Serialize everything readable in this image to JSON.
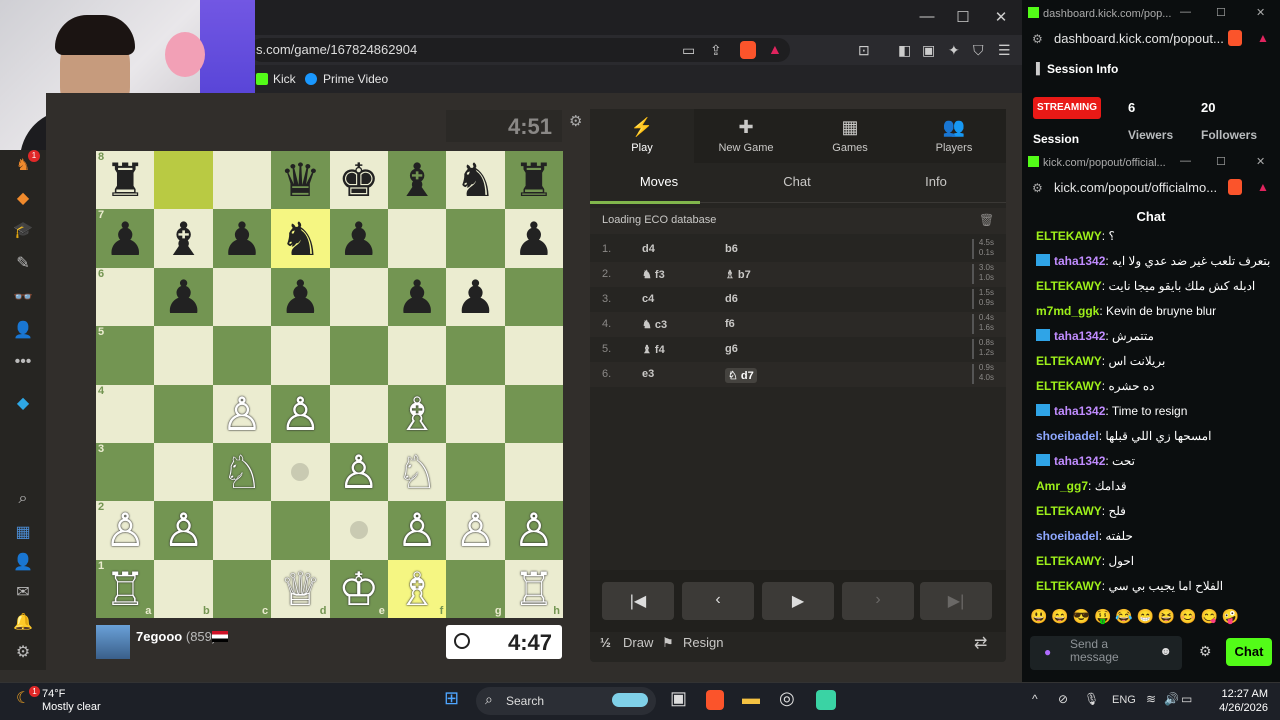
{
  "browser": {
    "url": "s.com/game/167824862904",
    "bookmarks": [
      "Kick",
      "Prime Video"
    ]
  },
  "sidebar": {
    "badge": "1"
  },
  "game": {
    "top_clock": "4:51",
    "bottom_clock": "4:47",
    "player_name": "7egooo",
    "player_rating": "(859)",
    "board": [
      [
        "♜",
        "",
        "",
        "♛",
        "♚",
        "♝",
        "♞",
        "♜"
      ],
      [
        "♟",
        "♝",
        "♟",
        "♞",
        "♟",
        "",
        "",
        "♟"
      ],
      [
        "",
        "♟",
        "",
        "♟",
        "",
        "♟",
        "♟",
        ""
      ],
      [
        "",
        "",
        "",
        "",
        "",
        "",
        "",
        ""
      ],
      [
        "",
        "",
        "♙",
        "♙",
        "",
        "♗",
        "",
        ""
      ],
      [
        "",
        "",
        "♘",
        "",
        "♙",
        "♘",
        "",
        ""
      ],
      [
        "♙",
        "♙",
        "",
        "",
        "",
        "♙",
        "♙",
        "♙"
      ],
      [
        "♖",
        "",
        "",
        "♕",
        "♔",
        "♗",
        "",
        "♖"
      ]
    ],
    "ranks": [
      "8",
      "7",
      "6",
      "5",
      "4",
      "3",
      "2",
      "1"
    ],
    "files": [
      "a",
      "b",
      "c",
      "d",
      "e",
      "f",
      "g",
      "h"
    ]
  },
  "panel": {
    "tabs": [
      {
        "label": "Play",
        "icon": "⚡"
      },
      {
        "label": "New Game",
        "icon": "✚"
      },
      {
        "label": "Games",
        "icon": "▦"
      },
      {
        "label": "Players",
        "icon": "👥"
      }
    ],
    "subtabs": [
      "Moves",
      "Chat",
      "Info"
    ],
    "eco": "Loading ECO database",
    "moves": [
      {
        "n": "1.",
        "w": "d4",
        "b": "b6",
        "tw": "4.5s",
        "tb": "0.1s"
      },
      {
        "n": "2.",
        "w": "♞ f3",
        "b": "♗ b7",
        "tw": "3.0s",
        "tb": "1.0s"
      },
      {
        "n": "3.",
        "w": "c4",
        "b": "d6",
        "tw": "1.5s",
        "tb": "0.9s"
      },
      {
        "n": "4.",
        "w": "♞ c3",
        "b": "f6",
        "tw": "0.4s",
        "tb": "1.6s"
      },
      {
        "n": "5.",
        "w": "♝ f4",
        "b": "g6",
        "tw": "0.8s",
        "tb": "1.2s"
      },
      {
        "n": "6.",
        "w": "e3",
        "b": "♘ d7",
        "tw": "0.9s",
        "tb": "4.0s"
      }
    ],
    "draw": "Draw",
    "draw_icon": "½",
    "resign": "Resign"
  },
  "kick1": {
    "title": "dashboard.kick.com/pop...",
    "url": "dashboard.kick.com/popout...",
    "header": "Session Info",
    "status": "STREAMING",
    "session_label": "Session",
    "viewers": "6",
    "viewers_label": "Viewers",
    "followers": "20",
    "followers_label": "Followers"
  },
  "kick2": {
    "title": "kick.com/popout/official...",
    "url": "kick.com/popout/officialmo...",
    "header": "Chat",
    "send_placeholder": "Send a message",
    "chat_button": "Chat",
    "messages": [
      {
        "user": "ELTEKAWY",
        "color": "#9ef01a",
        "text": "؟",
        "badge": false
      },
      {
        "user": "taha1342",
        "color": "#c18cff",
        "text": "انت مش بتعرف تلعب غير ضد عدي ولا ايه",
        "badge": true
      },
      {
        "user": "ELTEKAWY",
        "color": "#9ef01a",
        "text": "ادبله كش ملك بايقو ميجا نايت",
        "badge": false
      },
      {
        "user": "m7md_ggk",
        "color": "#9ef01a",
        "text": "Kevin de bruyne blur",
        "badge": false
      },
      {
        "user": "taha1342",
        "color": "#c18cff",
        "text": "متتمرش",
        "badge": true
      },
      {
        "user": "ELTEKAWY",
        "color": "#9ef01a",
        "text": "بريلانت اس",
        "badge": false
      },
      {
        "user": "ELTEKAWY",
        "color": "#9ef01a",
        "text": "ده حشره",
        "badge": false
      },
      {
        "user": "taha1342",
        "color": "#c18cff",
        "text": "Time to resign",
        "badge": true
      },
      {
        "user": "shoeibadel",
        "color": "#8fa8ff",
        "text": "امسحها زي اللي قبلها",
        "badge": false
      },
      {
        "user": "taha1342",
        "color": "#c18cff",
        "text": "تحت",
        "badge": true
      },
      {
        "user": "Amr_gg7",
        "color": "#9ef01a",
        "text": "قدامك",
        "badge": false
      },
      {
        "user": "ELTEKAWY",
        "color": "#9ef01a",
        "text": "فلح",
        "badge": false
      },
      {
        "user": "shoeibadel",
        "color": "#8fa8ff",
        "text": "حلفته",
        "badge": false
      },
      {
        "user": "ELTEKAWY",
        "color": "#9ef01a",
        "text": "احول",
        "badge": false
      },
      {
        "user": "ELTEKAWY",
        "color": "#9ef01a",
        "text": "الفلاح اما يجيب بي سي",
        "badge": false
      }
    ]
  },
  "taskbar": {
    "temp": "74°F",
    "weather": "Mostly clear",
    "weather_badge": "1",
    "search": "Search",
    "lang": "ENG",
    "time": "12:27 AM",
    "date": "4/26/2026"
  },
  "colors": {
    "board_light": "#ebecd0",
    "board_dark": "#739552",
    "kick_green": "#53fc18",
    "live_red": "#e91916"
  }
}
